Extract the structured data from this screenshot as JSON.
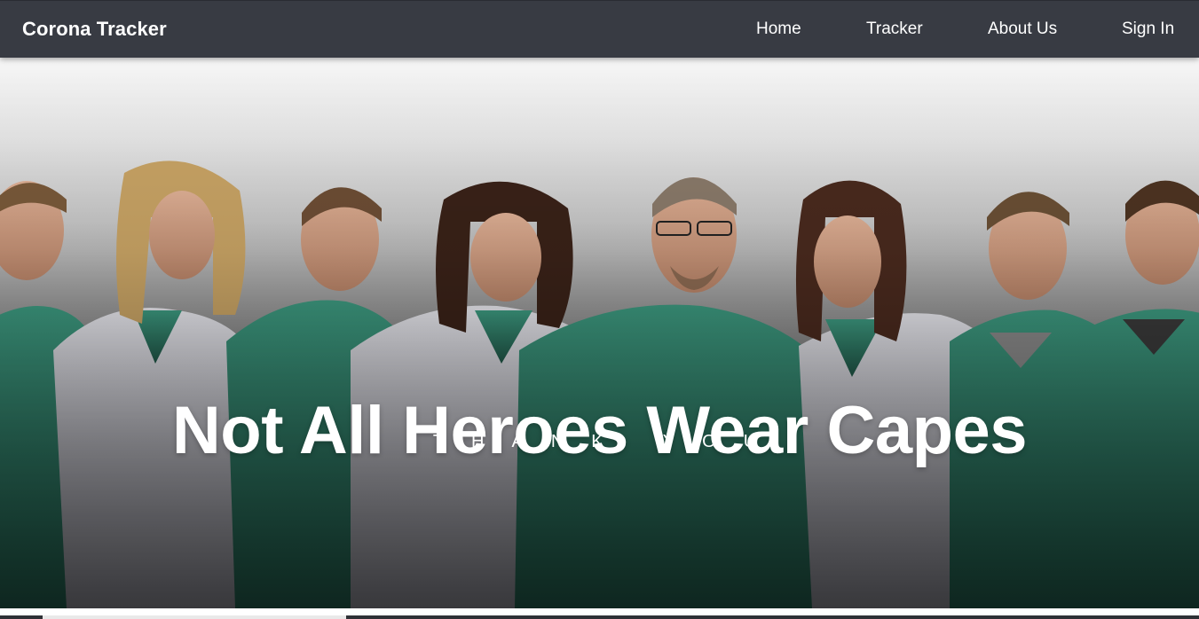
{
  "navbar": {
    "brand": "Corona Tracker",
    "links": {
      "home": "Home",
      "tracker": "Tracker",
      "about": "About Us",
      "signin": "Sign In"
    },
    "background_color": "#383b43"
  },
  "hero": {
    "title": "Not All Heroes Wear Capes",
    "subtitle": "THANK YOU",
    "image_description_icon": "healthcare-workers-photo",
    "scrub_color": "#2f7f6a"
  }
}
